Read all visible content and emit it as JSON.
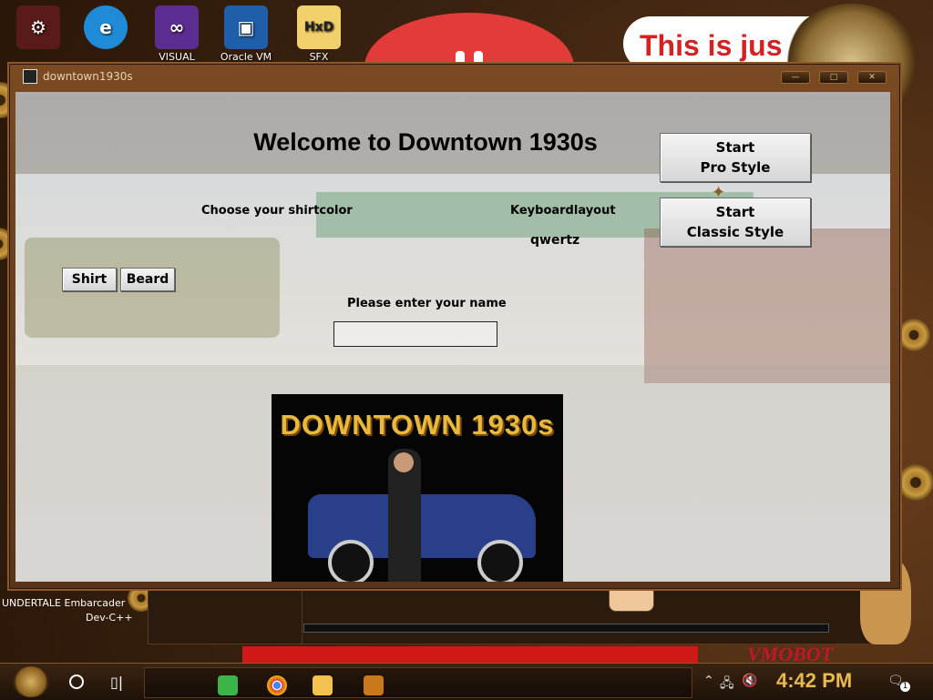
{
  "desktop": {
    "icons": [
      {
        "label": "VISUAL",
        "name": "visual-studio-icon",
        "color": "#5c2d91",
        "glyph": "VS"
      },
      {
        "label": "Oracle VM",
        "name": "virtualbox-icon",
        "color": "#1f5ea8",
        "glyph": "▣"
      },
      {
        "label": "SFX",
        "name": "hxd-icon",
        "color": "#f2d06b",
        "glyph": "HxD"
      }
    ],
    "speech_text": "This is jus",
    "undertale_text": "UNDERTALE Embarcader",
    "devcpp_text": "Dev-C++",
    "vm_logo": "VMOBOT"
  },
  "window": {
    "title": "downtown1930s"
  },
  "game": {
    "welcome": "Welcome to Downtown 1930s",
    "shirtcolor_label": "Choose your shirtcolor",
    "keyboard_label": "Keyboardlayout",
    "keyboard_value": "qwertz",
    "name_prompt": "Please enter your name",
    "name_value": "",
    "shirt_button": "Shirt",
    "beard_button": "Beard",
    "start_pro_line1": "Start",
    "start_pro_line2": "Pro Style",
    "start_classic_line1": "Start",
    "start_classic_line2": "Classic Style",
    "poster_title": "DOWNTOWN 1930s"
  },
  "taskbar": {
    "time": "4:42 PM",
    "notification_count": "1"
  },
  "colors": {
    "accent": "#e8b950",
    "window_frame": "#7a4a22",
    "speech_red": "#d42222"
  }
}
